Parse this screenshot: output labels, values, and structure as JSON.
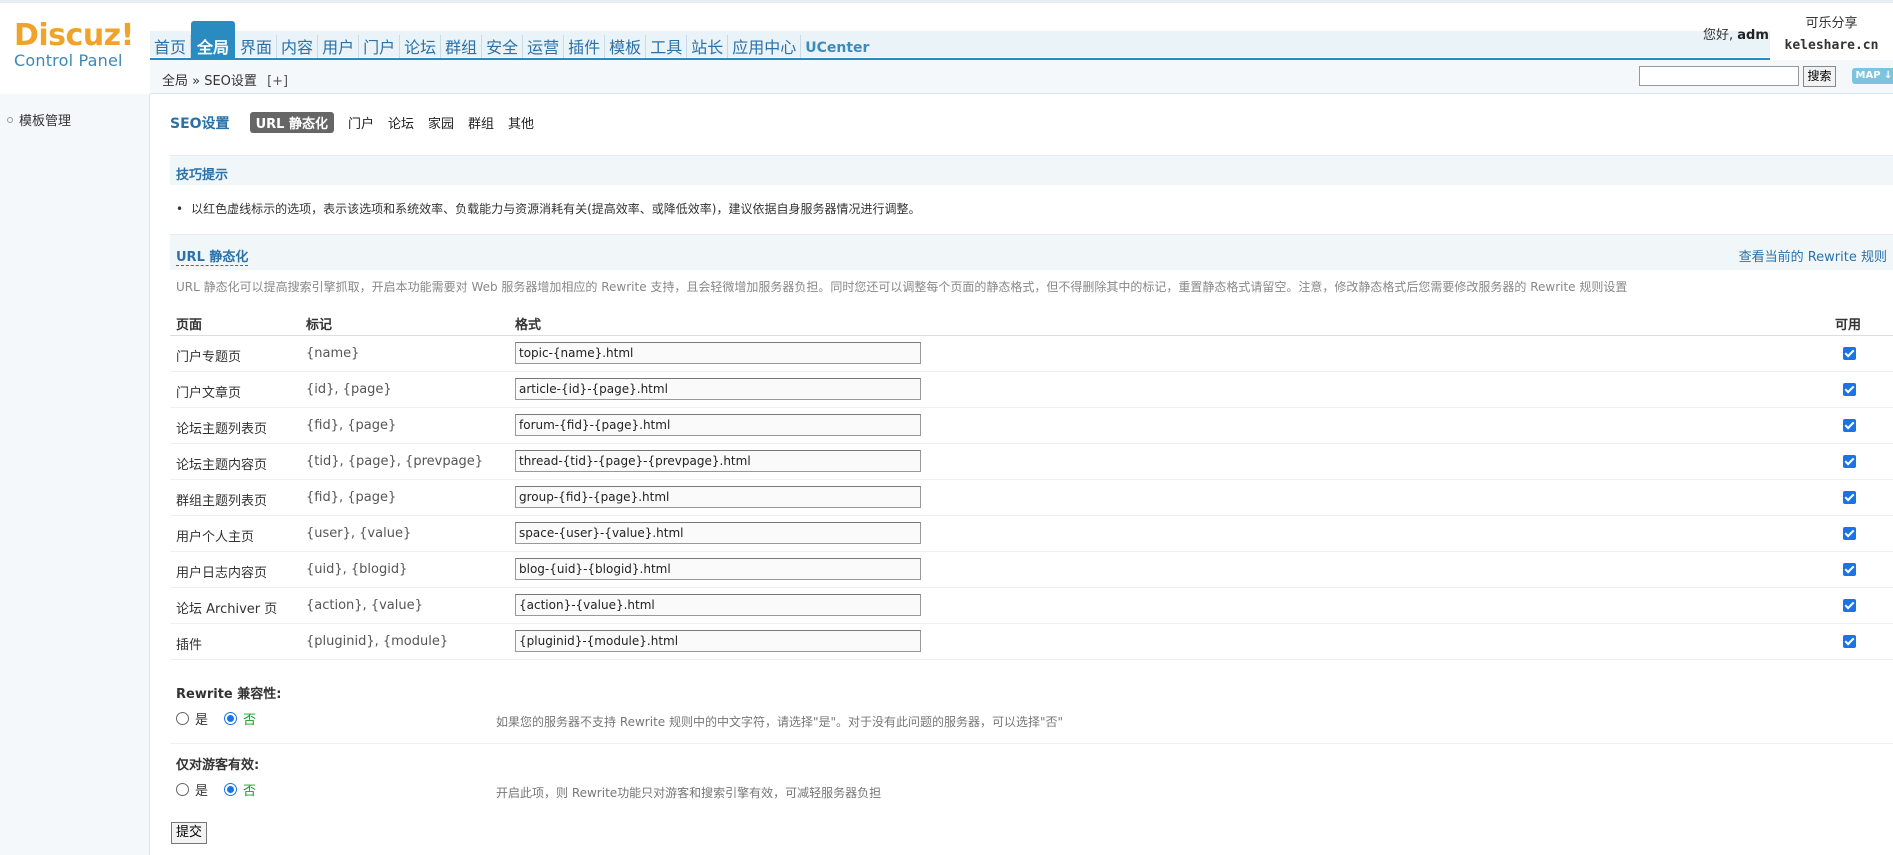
{
  "header": {
    "logo_text": "Discuz!",
    "logo_sub": "Control Panel",
    "nav": [
      {
        "label": "首页"
      },
      {
        "label": "全局",
        "active": true
      },
      {
        "label": "界面"
      },
      {
        "label": "内容"
      },
      {
        "label": "用户"
      },
      {
        "label": "门户"
      },
      {
        "label": "论坛"
      },
      {
        "label": "群组"
      },
      {
        "label": "安全"
      },
      {
        "label": "运营"
      },
      {
        "label": "插件"
      },
      {
        "label": "模板"
      },
      {
        "label": "工具"
      },
      {
        "label": "站长"
      },
      {
        "label": "应用中心"
      },
      {
        "label": "UCenter"
      }
    ],
    "greeting_prefix": "您好,",
    "username": "admin",
    "watermark_line1": "可乐分享",
    "watermark_line2": "keleshare.cn"
  },
  "subbar": {
    "breadcrumb": "全局 » SEO设置",
    "breadcrumb_add": "[+]",
    "search_value": "",
    "search_button": "搜索",
    "map_button": "MAP ↓"
  },
  "sidebar": {
    "items": [
      {
        "label": "模板管理"
      }
    ]
  },
  "tabs": {
    "title": "SEO设置",
    "items": [
      {
        "label": "URL 静态化",
        "current": true
      },
      {
        "label": "门户"
      },
      {
        "label": "论坛"
      },
      {
        "label": "家园"
      },
      {
        "label": "群组"
      },
      {
        "label": "其他"
      }
    ]
  },
  "tips": {
    "title": "技巧提示",
    "bullet": "•",
    "text": "以红色虚线标示的选项，表示该选项和系统效率、负载能力与资源消耗有关(提高效率、或降低效率)，建议依据自身服务器情况进行调整。"
  },
  "url_section": {
    "title": "URL 静态化",
    "view_rules": "查看当前的 Rewrite 规则",
    "description": "URL 静态化可以提高搜索引擎抓取，开启本功能需要对 Web 服务器增加相应的 Rewrite 支持，且会轻微增加服务器负担。同时您还可以调整每个页面的静态格式，但不得删除其中的标记，重置静态格式请留空。注意，修改静态格式后您需要修改服务器的 Rewrite 规则设置",
    "columns": {
      "page": "页面",
      "mark": "标记",
      "format": "格式",
      "enable": "可用"
    },
    "rows": [
      {
        "page": "门户专题页",
        "mark": "{name}",
        "format": "topic-{name}.html",
        "enabled": true
      },
      {
        "page": "门户文章页",
        "mark": "{id}, {page}",
        "format": "article-{id}-{page}.html",
        "enabled": true
      },
      {
        "page": "论坛主题列表页",
        "mark": "{fid}, {page}",
        "format": "forum-{fid}-{page}.html",
        "enabled": true
      },
      {
        "page": "论坛主题内容页",
        "mark": "{tid}, {page}, {prevpage}",
        "format": "thread-{tid}-{page}-{prevpage}.html",
        "enabled": true
      },
      {
        "page": "群组主题列表页",
        "mark": "{fid}, {page}",
        "format": "group-{fid}-{page}.html",
        "enabled": true
      },
      {
        "page": "用户个人主页",
        "mark": "{user}, {value}",
        "format": "space-{user}-{value}.html",
        "enabled": true
      },
      {
        "page": "用户日志内容页",
        "mark": "{uid}, {blogid}",
        "format": "blog-{uid}-{blogid}.html",
        "enabled": true
      },
      {
        "page": "论坛 Archiver 页",
        "mark": "{action}, {value}",
        "format": "{action}-{value}.html",
        "enabled": true
      },
      {
        "page": "插件",
        "mark": "{pluginid}, {module}",
        "format": "{pluginid}-{module}.html",
        "enabled": true
      }
    ]
  },
  "options": {
    "rewrite_compat": {
      "title": "Rewrite 兼容性:",
      "yes": "是",
      "no": "否",
      "selected": "否",
      "description": "如果您的服务器不支持 Rewrite 规则中的中文字符，请选择\"是\"。对于没有此问题的服务器，可以选择\"否\""
    },
    "guest_only": {
      "title": "仅对游客有效:",
      "yes": "是",
      "no": "否",
      "selected": "否",
      "description": "开启此项，则 Rewrite功能只对游客和搜索引擎有效，可减轻服务器负担"
    }
  },
  "submit_label": "提交"
}
